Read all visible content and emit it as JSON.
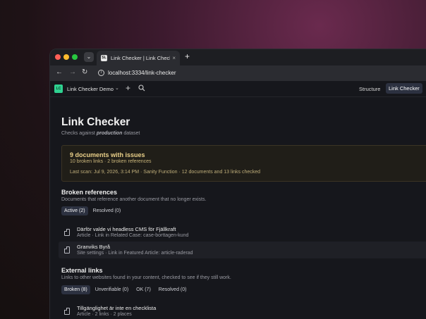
{
  "browser": {
    "tab_title": "Link Checker | Link Checker",
    "tab_favicon": "SL",
    "url": "localhost:3334/link-checker"
  },
  "app": {
    "logo_text": "LC",
    "workspace": "Link Checker Demo",
    "nav": {
      "structure": "Structure",
      "link_checker": "Link Checker"
    },
    "accent_color": "#2fd291"
  },
  "page": {
    "title": "Link Checker",
    "subtitle_prefix": "Checks against ",
    "subtitle_dataset": "production",
    "subtitle_suffix": " dataset"
  },
  "issues": {
    "title": "9 documents with issues",
    "summary": "10 broken links · 2 broken references",
    "last_scan": "Last scan: Jul 9, 2026, 3:14 PM · Sanity Function · 12 documents and 13 links checked"
  },
  "broken_references": {
    "title": "Broken references",
    "description": "Documents that reference another document that no longer exists.",
    "filters": [
      "Active (2)",
      "Resolved (0)"
    ],
    "items": [
      {
        "title": "Därför valde vi headless CMS för Fjällkraft",
        "meta": "Article · Link in Related Case: case-borttagen-kund"
      },
      {
        "title": "Granviks Byrå",
        "meta": "Site settings · Link in Featured Article: article-raderad"
      }
    ]
  },
  "external_links": {
    "title": "External links",
    "description": "Links to other websites found in your content, checked to see if they still work.",
    "filters": [
      "Broken (8)",
      "Unverifiable (0)",
      "OK (7)",
      "Resolved (0)"
    ],
    "items": [
      {
        "title": "Tillgänglighet är inte en checklista",
        "meta": "Article · 2 links · 2 places"
      }
    ]
  }
}
